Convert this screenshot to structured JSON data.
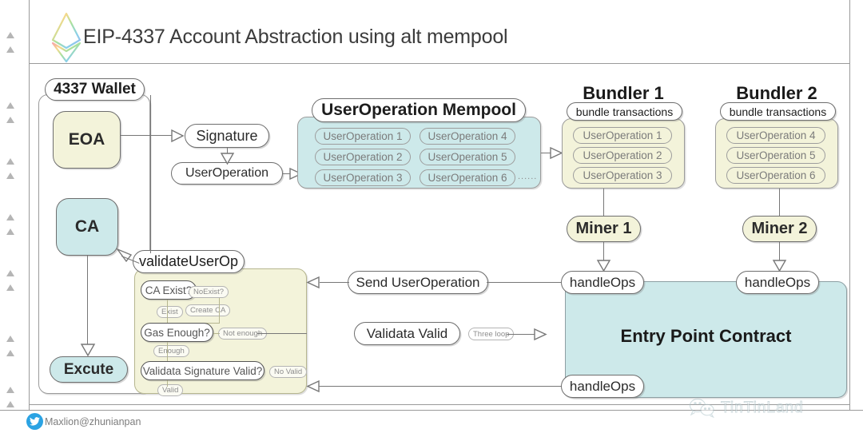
{
  "header": {
    "title": "EIP-4337 Account Abstraction using alt mempool",
    "logo_icon": "ethereum-logo-icon"
  },
  "wallet": {
    "title": "4337 Wallet",
    "eoa": "EOA",
    "ca": "CA",
    "execute": "Excute"
  },
  "flow": {
    "signature": "Signature",
    "user_operation": "UserOperation",
    "validate_user_op": "validateUserOp",
    "send_user_operation": "Send UserOperation",
    "validata_valid": "Validata Valid",
    "three_loop": "Three loop"
  },
  "validate_steps": [
    {
      "label": "CA Exist?",
      "yes": "Exist",
      "no": "NoExist?",
      "no_action": "Create CA"
    },
    {
      "label": "Gas Enough?",
      "yes": "Enough",
      "no": "Not enough",
      "no_action": ""
    },
    {
      "label": "Validata Signature Valid?",
      "yes": "Valid",
      "no": "No Valid",
      "no_action": ""
    }
  ],
  "mempool": {
    "title": "UserOperation Mempool",
    "col1": [
      "UserOperation 1",
      "UserOperation 2",
      "UserOperation 3"
    ],
    "col2": [
      "UserOperation 4",
      "UserOperation 5",
      "UserOperation 6"
    ],
    "ellipsis": "......"
  },
  "bundlers": [
    {
      "title": "Bundler 1",
      "subtitle": "bundle transactions",
      "ops": [
        "UserOperation 1",
        "UserOperation 2",
        "UserOperation 3"
      ],
      "miner": "Miner 1",
      "handle_ops": "handleOps"
    },
    {
      "title": "Bundler 2",
      "subtitle": "bundle transactions",
      "ops": [
        "UserOperation 4",
        "UserOperation 5",
        "UserOperation 6"
      ],
      "miner": "Miner 2",
      "handle_ops": "handleOps"
    }
  ],
  "entry_point": {
    "title": "Entry Point Contract",
    "handle_ops_bottom": "handleOps"
  },
  "footer": {
    "twitter_icon": "twitter-bird-icon",
    "twitter_handle": "Maxlion@zhunianpan",
    "watermark_icon": "wechat-icon",
    "watermark_text": "TinTinLand"
  },
  "colors": {
    "yellow_fill": "#f3f3da",
    "cyan_fill": "#cde9ea",
    "stroke": "#6e6e6e",
    "text": "#2b2b2b",
    "twitter_blue": "#2ba3e3"
  }
}
